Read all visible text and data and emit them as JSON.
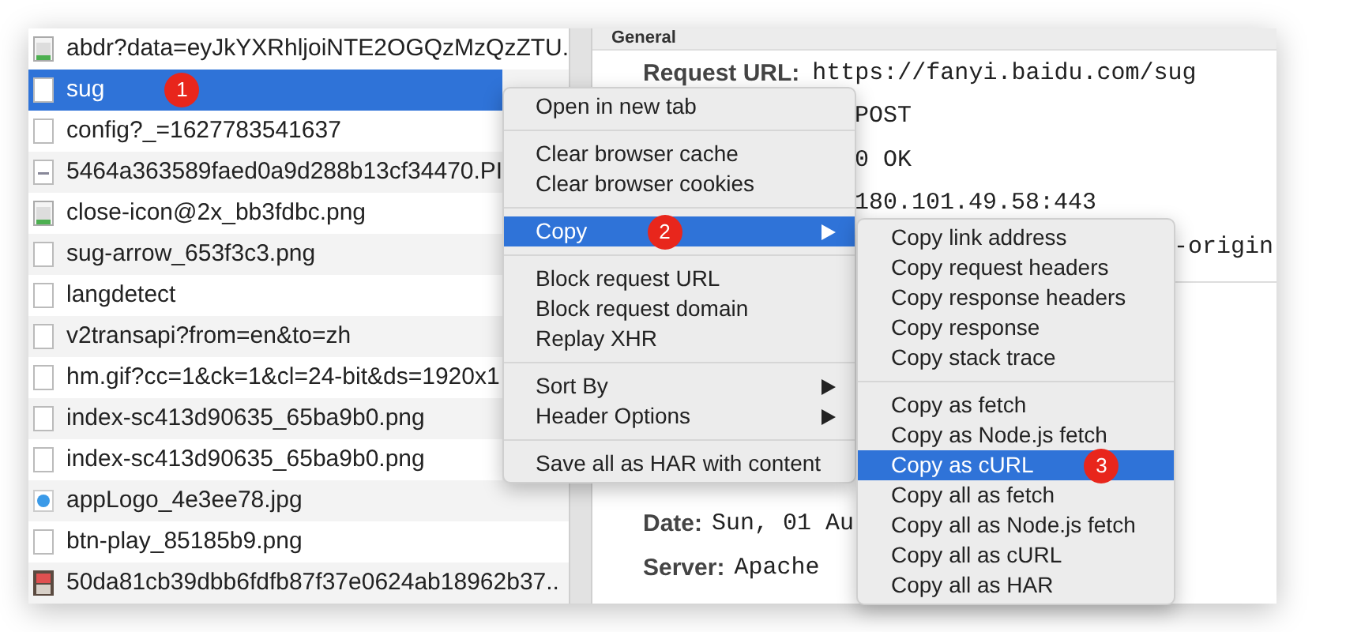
{
  "requests": [
    {
      "name": "abdr?data=eyJkYXRhljoiNTE2OGQzMzQzZTU.",
      "kind": "image",
      "selected": false
    },
    {
      "name": "sug",
      "kind": "blank",
      "selected": true,
      "badge": "1"
    },
    {
      "name": "config?_=1627783541637",
      "kind": "blank",
      "selected": false
    },
    {
      "name": "5464a363589faed0a9d288b13cf34470.PI",
      "kind": "dash",
      "selected": false
    },
    {
      "name": "close-icon@2x_bb3fdbc.png",
      "kind": "image",
      "selected": false
    },
    {
      "name": "sug-arrow_653f3c3.png",
      "kind": "blank",
      "selected": false
    },
    {
      "name": "langdetect",
      "kind": "blank",
      "selected": false
    },
    {
      "name": "v2transapi?from=en&to=zh",
      "kind": "blank",
      "selected": false
    },
    {
      "name": "hm.gif?cc=1&ck=1&cl=24-bit&ds=1920x1",
      "kind": "blank",
      "selected": false
    },
    {
      "name": "index-sc413d90635_65ba9b0.png",
      "kind": "blank",
      "selected": false
    },
    {
      "name": "index-sc413d90635_65ba9b0.png",
      "kind": "blank",
      "selected": false
    },
    {
      "name": "appLogo_4e3ee78.jpg",
      "kind": "logo",
      "selected": false
    },
    {
      "name": "btn-play_85185b9.png",
      "kind": "blank",
      "selected": false
    },
    {
      "name": "50da81cb39dbb6fdfb87f37e0624ab18962b37..",
      "kind": "photo",
      "selected": false
    }
  ],
  "general": {
    "title": "General",
    "rows": [
      {
        "kind": "full",
        "label": "Request URL:",
        "value": "https://fanyi.baidu.com/sug"
      },
      {
        "kind": "behind-menu",
        "value": "POST"
      },
      {
        "kind": "behind-menu",
        "value": "0 OK"
      },
      {
        "kind": "behind-menu",
        "value": "180.101.49.58:443"
      },
      {
        "kind": "behind-submenu",
        "value": "-origin"
      }
    ]
  },
  "headers": {
    "rows": [
      {
        "label": "Date:",
        "value": "Sun, 01 Au"
      },
      {
        "label": "Server:",
        "value": "Apache"
      }
    ]
  },
  "context_menu": {
    "groups": [
      [
        {
          "label": "Open in new tab",
          "selected": false,
          "submenu": false
        }
      ],
      [
        {
          "label": "Clear browser cache",
          "selected": false,
          "submenu": false
        },
        {
          "label": "Clear browser cookies",
          "selected": false,
          "submenu": false
        }
      ],
      [
        {
          "label": "Copy",
          "selected": true,
          "submenu": true,
          "badge": "2"
        }
      ],
      [
        {
          "label": "Block request URL",
          "selected": false,
          "submenu": false
        },
        {
          "label": "Block request domain",
          "selected": false,
          "submenu": false
        },
        {
          "label": "Replay XHR",
          "selected": false,
          "submenu": false
        }
      ],
      [
        {
          "label": "Sort By",
          "selected": false,
          "submenu": true
        },
        {
          "label": "Header Options",
          "selected": false,
          "submenu": true
        }
      ],
      [
        {
          "label": "Save all as HAR with content",
          "selected": false,
          "submenu": false
        }
      ]
    ]
  },
  "copy_submenu": {
    "groups": [
      [
        {
          "label": "Copy link address",
          "selected": false
        },
        {
          "label": "Copy request headers",
          "selected": false
        },
        {
          "label": "Copy response headers",
          "selected": false
        },
        {
          "label": "Copy response",
          "selected": false
        },
        {
          "label": "Copy stack trace",
          "selected": false
        }
      ],
      [
        {
          "label": "Copy as fetch",
          "selected": false
        },
        {
          "label": "Copy as Node.js fetch",
          "selected": false
        },
        {
          "label": "Copy as cURL",
          "selected": true,
          "badge": "3"
        },
        {
          "label": "Copy all as fetch",
          "selected": false
        },
        {
          "label": "Copy all as Node.js fetch",
          "selected": false
        },
        {
          "label": "Copy all as cURL",
          "selected": false
        },
        {
          "label": "Copy all as HAR",
          "selected": false
        }
      ]
    ]
  }
}
